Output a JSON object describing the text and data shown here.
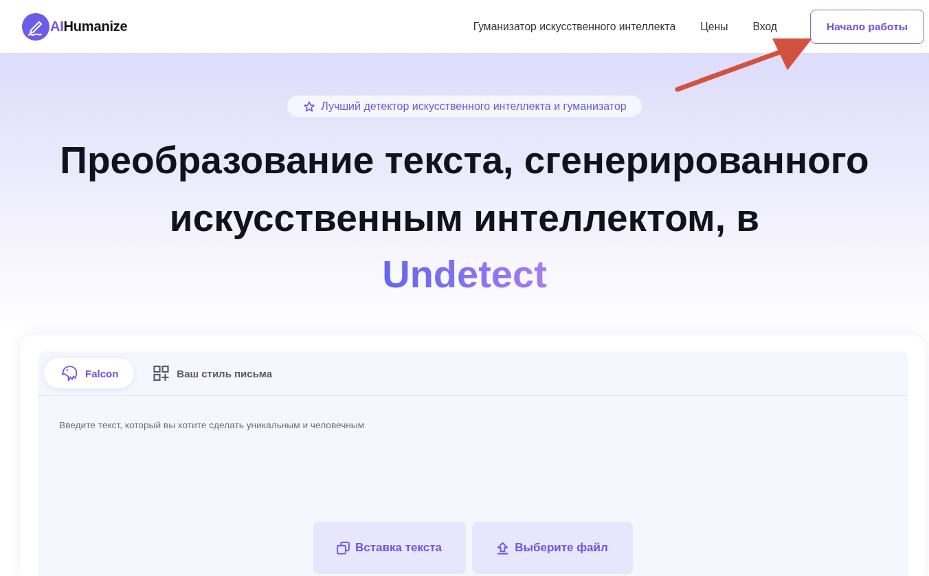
{
  "header": {
    "logo": {
      "accent": "AI",
      "name": "Humanize"
    },
    "nav": [
      "Гуманизатор искусственного интеллекта",
      "Цены",
      "Вход"
    ],
    "cta": "Начало работы"
  },
  "hero": {
    "badge": "Лучший детектор искусственного интеллекта и гуманизатор",
    "title": "Преобразование текста, сгенерированного искусственным интеллектом, в",
    "title_highlight": "Undetect"
  },
  "editor": {
    "tabs": [
      {
        "label": "Falcon",
        "kind": "falcon",
        "selected": true
      },
      {
        "label": "Ваш стиль письма",
        "kind": "style",
        "selected": false
      }
    ],
    "placeholder": "Введите текст, который вы хотите сделать уникальным и человечным",
    "actions": [
      {
        "label": "Вставка текста",
        "kind": "paste"
      },
      {
        "label": "Выберите файл",
        "kind": "upload"
      }
    ]
  }
}
